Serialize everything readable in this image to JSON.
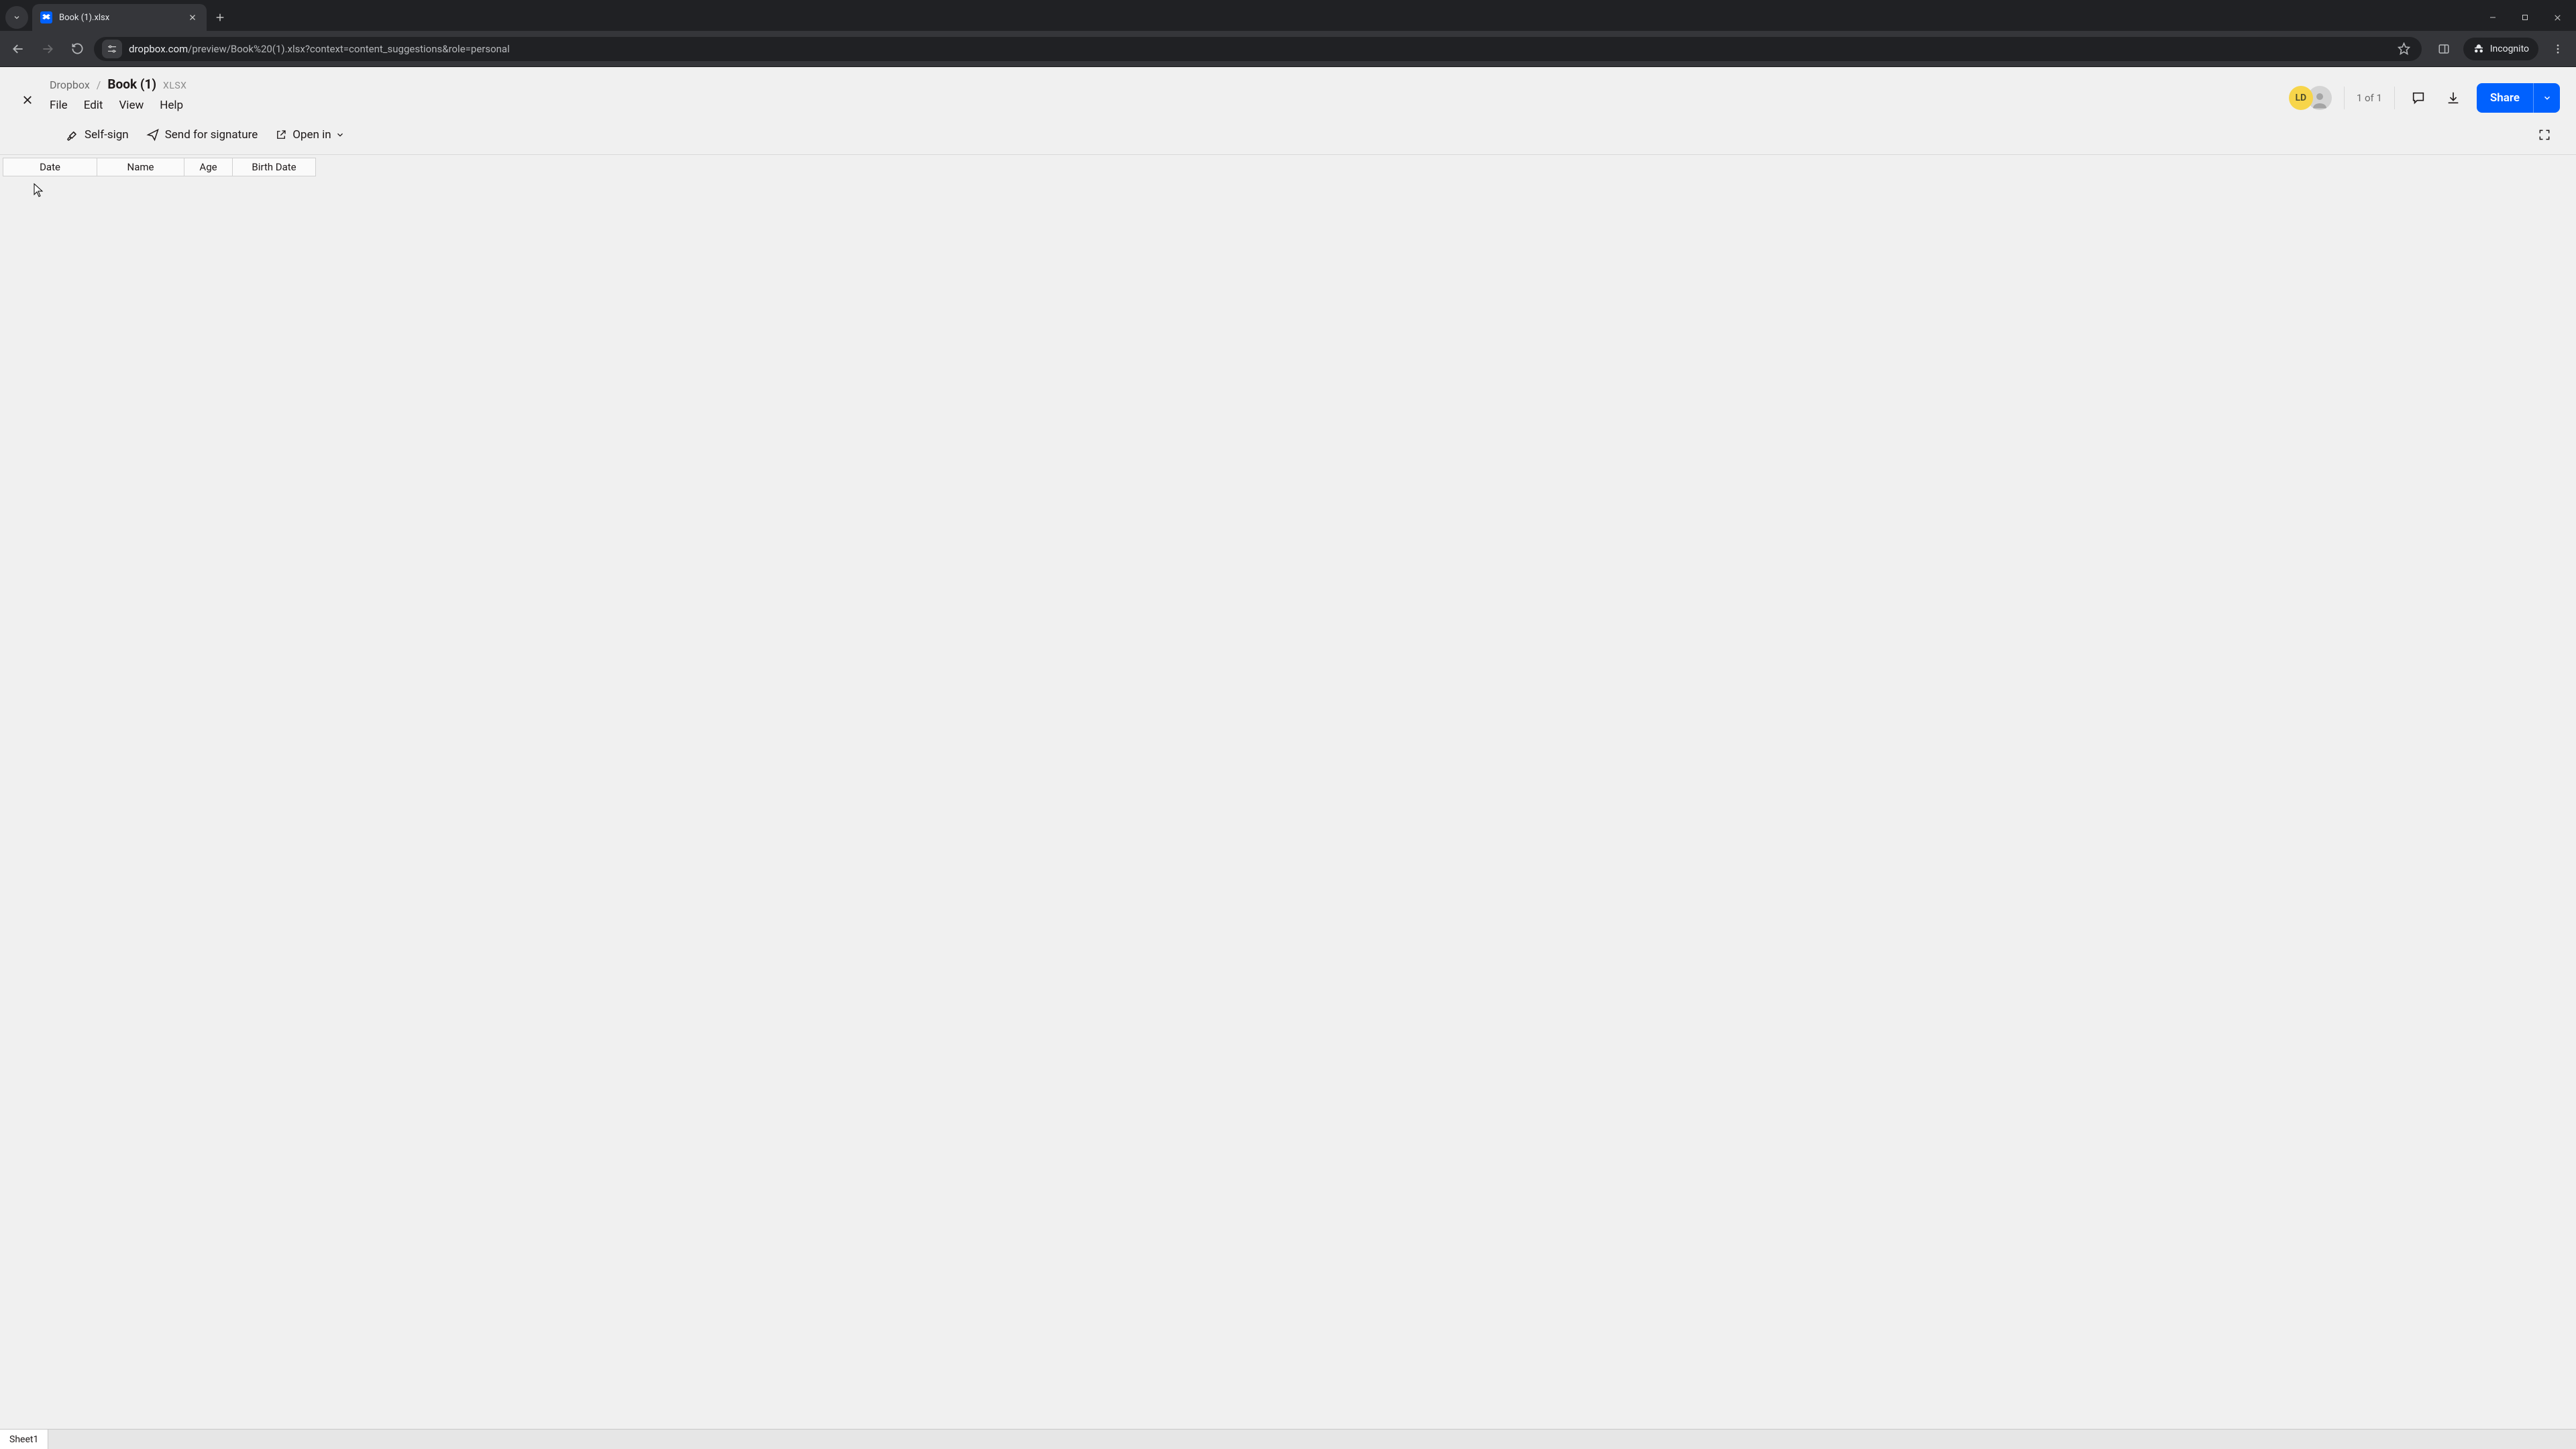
{
  "browser": {
    "tab_title": "Book (1).xlsx",
    "url_host": "dropbox.com",
    "url_path": "/preview/Book%20(1).xlsx?context=content_suggestions&role=personal",
    "incognito_label": "Incognito"
  },
  "header": {
    "breadcrumb_root": "Dropbox",
    "file_name": "Book (1)",
    "file_ext": "XLSX",
    "menu": {
      "file": "File",
      "edit": "Edit",
      "view": "View",
      "help": "Help"
    },
    "avatar_initials": "LD",
    "page_counter": "1 of 1",
    "share_label": "Share"
  },
  "actions": {
    "self_sign": "Self-sign",
    "send_signature": "Send for signature",
    "open_in": "Open in"
  },
  "sheet": {
    "columns": [
      "Date",
      "Name",
      "Age",
      "Birth Date"
    ],
    "active_tab": "Sheet1"
  },
  "colors": {
    "accent": "#0061fe",
    "avatar_bg": "#f7d54a"
  }
}
